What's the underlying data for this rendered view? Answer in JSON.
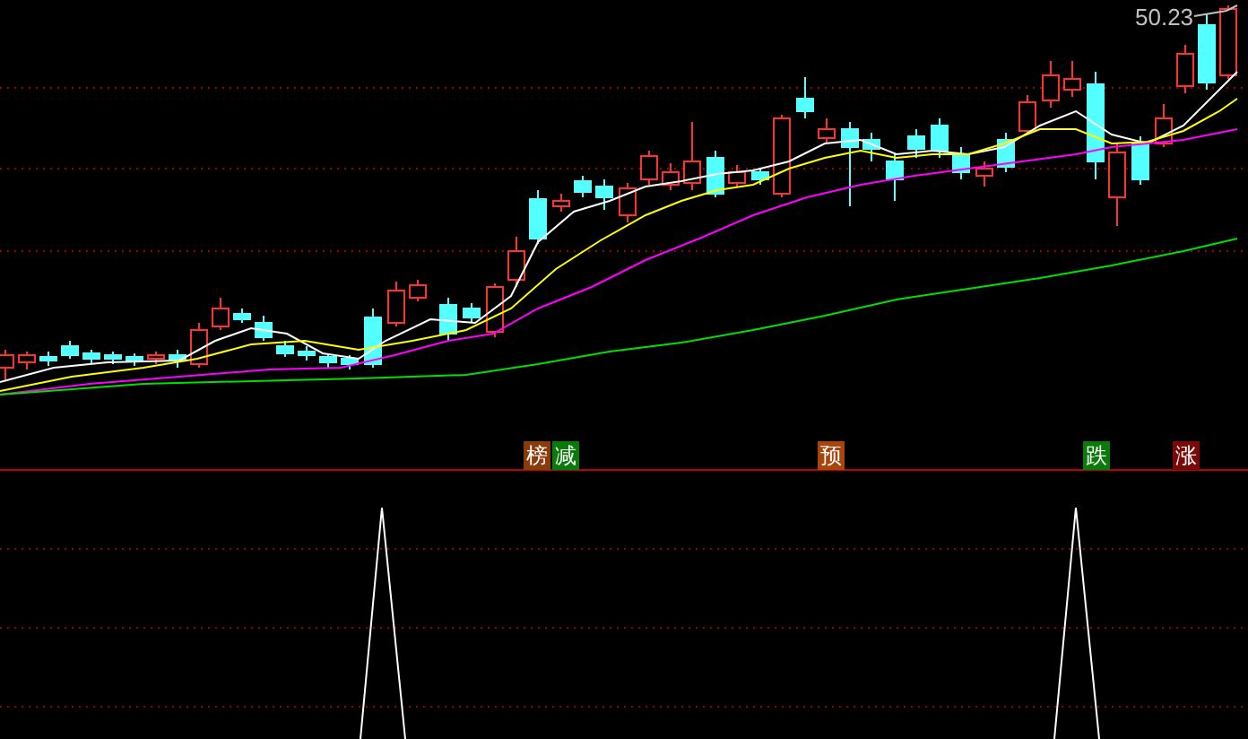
{
  "price_chart": {
    "high_price_label": "50.23",
    "signals": [
      {
        "text": "榜",
        "color": "#8b3a0a"
      },
      {
        "text": "减",
        "color": "#0a7a0a"
      },
      {
        "text": "预",
        "color": "#a8440c"
      },
      {
        "text": "跌",
        "color": "#0a7a0a"
      },
      {
        "text": "涨",
        "color": "#7a0a0a"
      }
    ]
  }
}
